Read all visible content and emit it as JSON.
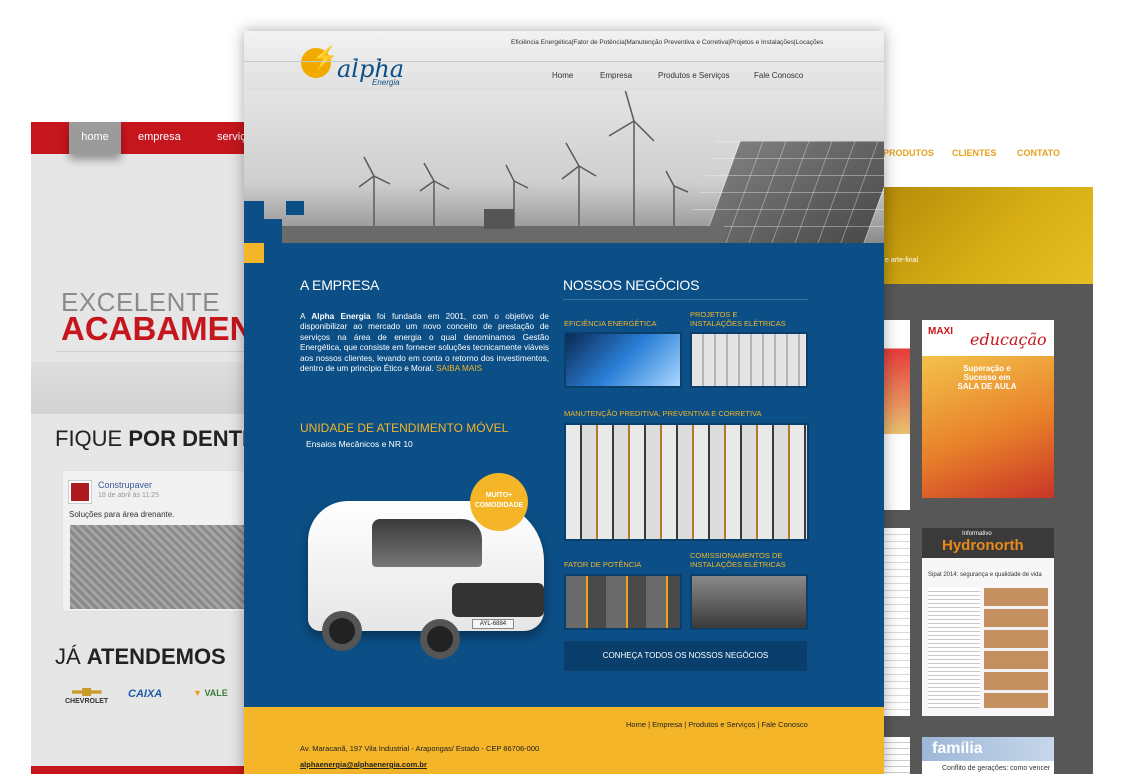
{
  "left_site": {
    "nav": [
      "home",
      "empresa",
      "serviç"
    ],
    "headline_small": "EXCELENTE",
    "headline_big": "ACABAMEN",
    "fique_a": "FIQUE ",
    "fique_b": "POR DENTRO",
    "post": {
      "author": "Construpaver",
      "date": "18 de abril às 11:25",
      "text": "Soluções para área drenante."
    },
    "ja_a": "JÁ ",
    "ja_b": "ATENDEMOS",
    "brands": [
      "CHEVROLET",
      "CAIXA",
      "VALE"
    ],
    "accent": "#c5161d"
  },
  "right_site": {
    "nav": [
      "PRODUTOS",
      "CLIENTES",
      "CONTATO"
    ],
    "banner_text": "e arte-final",
    "magazines": [
      {
        "title": "educação",
        "brand": "MAXI",
        "headline": "Superação e Sucesso em SALA DE AULA"
      },
      {
        "title": "Hydronorth",
        "kicker": "Informativo",
        "headline": "Sipat 2014: segurança e qualidade de vida"
      },
      {
        "title": "família",
        "headline": "Conflito de gerações: como vencer"
      }
    ]
  },
  "main_site": {
    "brand": {
      "name": "alpha",
      "sub": "Energia",
      "bolt": "⚡"
    },
    "top_links": "Eficiência Energética|Fator de Potência|Manutenção Preventiva e Corretiva|Projetos e Instalações|Locações",
    "menu": [
      "Home",
      "Empresa",
      "Produtos e Serviços",
      "Fale Conosco"
    ],
    "empresa": {
      "title": "A EMPRESA",
      "lead": "A ",
      "company": "Alpha Energia",
      "body": " foi fundada em 2001, com o objetivo de disponibilizar ao mercado um novo conceito de prestação de serviços na área de energia o qual denominamos Gestão Energética, que consiste em fornecer soluções tecnicamente viáveis aos nossos clientes, levando em conta o retorno dos investimentos, dentro de um princípio Ético e Moral. ",
      "more": "SAIBA MAIS"
    },
    "negocios": {
      "title": "NOSSOS NEGÓCIOS",
      "items": [
        "EFICIÊNCIA ENERGÉTICA",
        "PROJETOS E INSTALAÇÕES ELÉTRICAS",
        "MANUTENÇÃO PREDITIVA, PREVENTIVA E CORRETIVA",
        "FATOR DE POTÊNCIA",
        "COMISSIONAMENTOS DE INSTALAÇÕES ELÉTRICAS"
      ],
      "cta": "CONHEÇA TODOS OS NOSSOS NEGÓCIOS"
    },
    "unidade": {
      "title": "UNIDADE DE ATENDIMENTO MÓVEL",
      "subtitle": "Ensaios Mecânicos e NR 10",
      "badge": "MUITO+ COMODIDADE",
      "plate": "AYL-6884"
    },
    "footer": {
      "links": "Home | Empresa | Produtos e Serviços | Fale Conosco",
      "address": "Av. Maracanã, 197 Vila Industrial - Arapongas/ Estado - CEP 86706-000",
      "email": "alphaenergia@alphaenergia.com.br"
    },
    "colors": {
      "primary": "#0b4f86",
      "accent": "#f4b529"
    }
  }
}
